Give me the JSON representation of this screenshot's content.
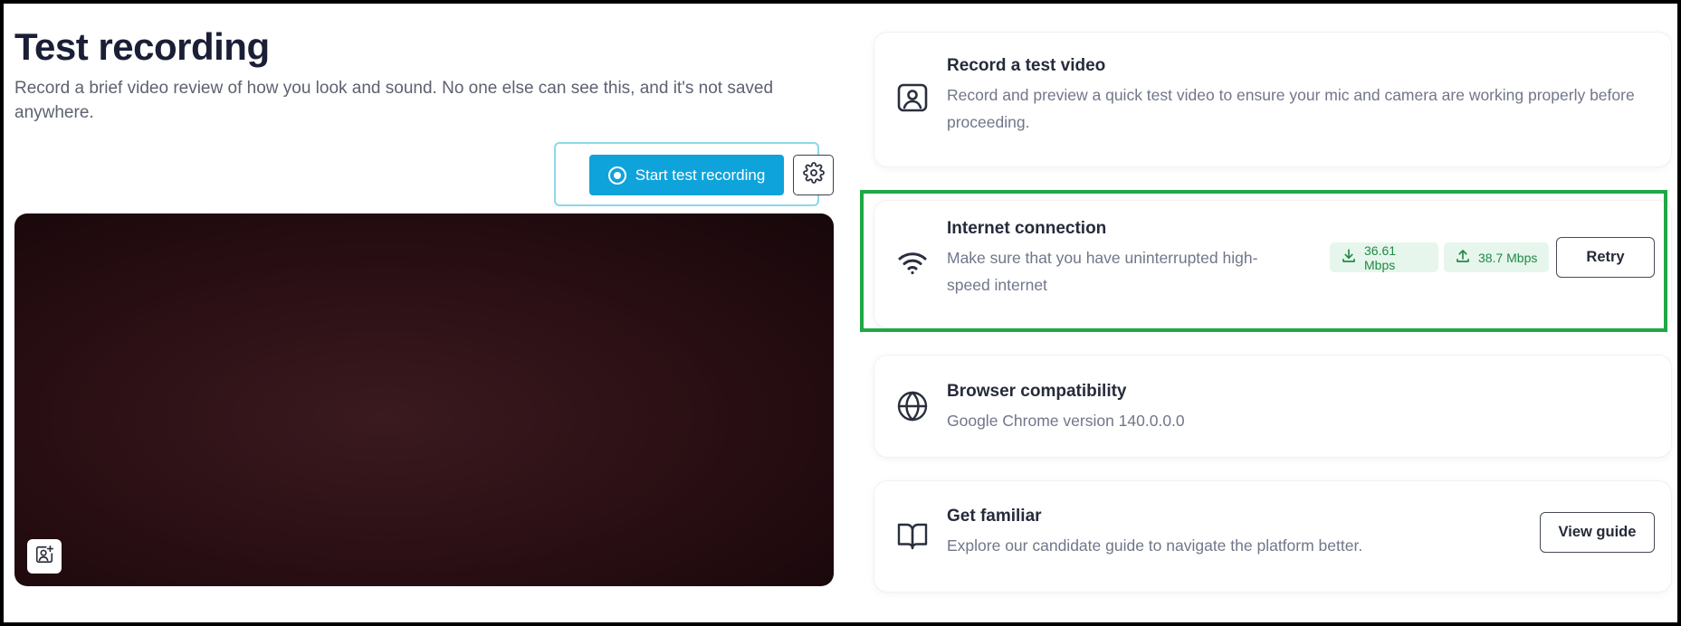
{
  "left": {
    "title": "Test recording",
    "subtitle": "Record a brief video review of how you look and sound. No one else can see this, and it's not saved anywhere.",
    "start_button_label": "Start test recording",
    "settings_icon": "gear-icon",
    "video_overlay_icon": "add-user-icon"
  },
  "cards": {
    "record": {
      "icon": "webcam-icon",
      "title": "Record a test video",
      "desc": "Record and preview a quick test video to ensure your mic and camera are working properly before proceeding."
    },
    "internet": {
      "icon": "wifi-icon",
      "title": "Internet connection",
      "desc": "Make sure that you have uninterrupted high-speed internet",
      "download_speed": "36.61 Mbps",
      "upload_speed": "38.7 Mbps",
      "retry_label": "Retry"
    },
    "browser": {
      "icon": "globe-icon",
      "title": "Browser compatibility",
      "desc": "Google Chrome version 140.0.0.0"
    },
    "familiar": {
      "icon": "book-icon",
      "title": "Get familiar",
      "desc": "Explore our candidate guide to navigate the platform better.",
      "guide_label": "View guide"
    }
  },
  "colors": {
    "primary": "#0fa3dc",
    "highlight": "#1fa846",
    "speed_bg": "#e6f6ec",
    "speed_text": "#1f8a45"
  }
}
